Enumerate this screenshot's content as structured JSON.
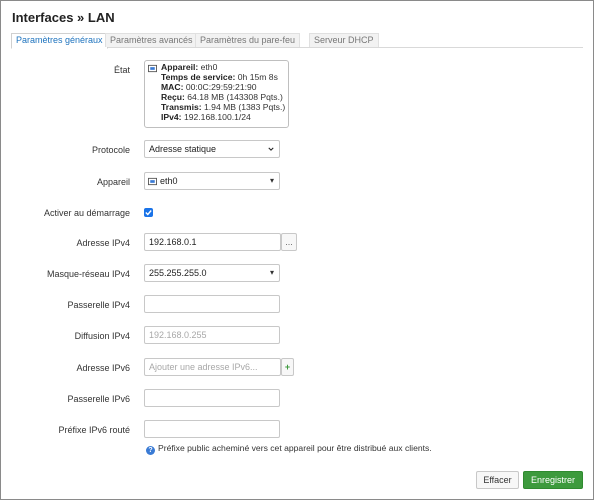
{
  "dialog": {
    "title": "Interfaces » LAN"
  },
  "tabs": [
    {
      "label": "Paramètres généraux",
      "active": true
    },
    {
      "label": "Paramètres avancés",
      "active": false
    },
    {
      "label": "Paramètres du pare-feu",
      "active": false
    },
    {
      "label": "Serveur DHCP",
      "active": false
    }
  ],
  "status": {
    "label": "État",
    "device_key": "Appareil:",
    "device_val": "eth0",
    "uptime_key": "Temps de service:",
    "uptime_val": "0h 15m 8s",
    "mac_key": "MAC:",
    "mac_val": "00:0C:29:59:21:90",
    "rx_key": "Reçu:",
    "rx_val": "64.18 MB (143308 Pqts.)",
    "tx_key": "Transmis:",
    "tx_val": "1.94 MB (1383 Pqts.)",
    "ipv4_key": "IPv4:",
    "ipv4_val": "192.168.100.1/24"
  },
  "form": {
    "protocol": {
      "label": "Protocole",
      "value": "Adresse statique"
    },
    "device": {
      "label": "Appareil",
      "value": "eth0"
    },
    "autostart": {
      "label": "Activer au démarrage",
      "checked": true
    },
    "ipv4_addr": {
      "label": "Adresse IPv4",
      "value": "192.168.0.1",
      "button": "..."
    },
    "netmask": {
      "label": "Masque-réseau IPv4",
      "value": "255.255.255.0"
    },
    "gateway4": {
      "label": "Passerelle IPv4",
      "value": ""
    },
    "broadcast": {
      "label": "Diffusion IPv4",
      "placeholder": "192.168.0.255"
    },
    "ipv6_addr": {
      "label": "Adresse IPv6",
      "placeholder": "Ajouter une adresse IPv6...",
      "button": "+"
    },
    "gateway6": {
      "label": "Passerelle IPv6",
      "value": ""
    },
    "prefix6": {
      "label": "Préfixe IPv6 routé",
      "value": "",
      "help": "Préfixe public acheminé vers cet appareil pour être distribué aux clients."
    }
  },
  "footer": {
    "reset": "Effacer",
    "save": "Enregistrer"
  },
  "colors": {
    "accent": "#1e73be",
    "save": "#3d9a3d",
    "checkbox": "#1a73e8"
  }
}
